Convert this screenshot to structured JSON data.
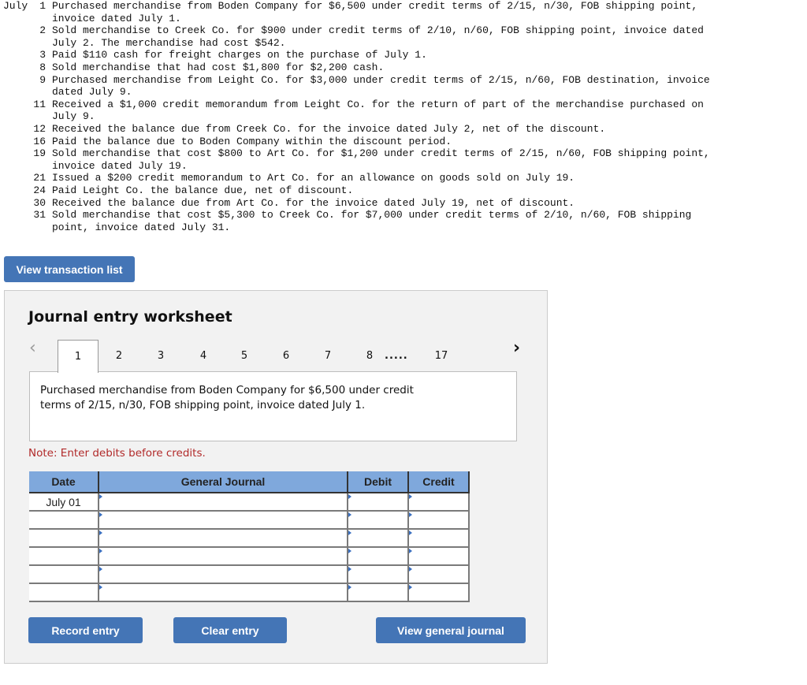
{
  "transactions": {
    "month": "July",
    "items": [
      {
        "day": "1",
        "text": "Purchased merchandise from Boden Company for $6,500 under credit terms of 2/15, n/30, FOB shipping point,\ninvoice dated July 1."
      },
      {
        "day": "2",
        "text": "Sold merchandise to Creek Co. for $900 under credit terms of 2/10, n/60, FOB shipping point, invoice dated\nJuly 2. The merchandise had cost $542."
      },
      {
        "day": "3",
        "text": "Paid $110 cash for freight charges on the purchase of July 1."
      },
      {
        "day": "8",
        "text": "Sold merchandise that had cost $1,800 for $2,200 cash."
      },
      {
        "day": "9",
        "text": "Purchased merchandise from Leight Co. for $3,000 under credit terms of 2/15, n/60, FOB destination, invoice\ndated July 9."
      },
      {
        "day": "11",
        "text": "Received a $1,000 credit memorandum from Leight Co. for the return of part of the merchandise purchased on\nJuly 9."
      },
      {
        "day": "12",
        "text": "Received the balance due from Creek Co. for the invoice dated July 2, net of the discount."
      },
      {
        "day": "16",
        "text": "Paid the balance due to Boden Company within the discount period."
      },
      {
        "day": "19",
        "text": "Sold merchandise that cost $800 to Art Co. for $1,200 under credit terms of 2/15, n/60, FOB shipping point,\ninvoice dated July 19."
      },
      {
        "day": "21",
        "text": "Issued a $200 credit memorandum to Art Co. for an allowance on goods sold on July 19."
      },
      {
        "day": "24",
        "text": "Paid Leight Co. the balance due, net of discount."
      },
      {
        "day": "30",
        "text": "Received the balance due from Art Co. for the invoice dated July 19, net of discount."
      },
      {
        "day": "31",
        "text": "Sold merchandise that cost $5,300 to Creek Co. for $7,000 under credit terms of 2/10, n/60, FOB shipping\npoint, invoice dated July 31."
      }
    ]
  },
  "buttons": {
    "view_transaction_list": "View transaction list",
    "record_entry": "Record entry",
    "clear_entry": "Clear entry",
    "view_general_journal": "View general journal"
  },
  "worksheet": {
    "title": "Journal entry worksheet",
    "nav_prev_icon": "chevron-left-icon",
    "nav_next_icon": "chevron-right-icon",
    "tabs": [
      "1",
      "2",
      "3",
      "4",
      "5",
      "6",
      "7",
      "8"
    ],
    "ellipsis": ".....",
    "last_tab": "17",
    "active_tab": "1",
    "description": "Purchased merchandise from Boden Company for $6,500 under credit terms of 2/15, n/30, FOB shipping point, invoice dated July 1.",
    "note": "Note: Enter debits before credits."
  },
  "journal_table": {
    "headers": {
      "date": "Date",
      "journal": "General Journal",
      "debit": "Debit",
      "credit": "Credit"
    },
    "rows": [
      {
        "date": "July 01",
        "account": "",
        "debit": "",
        "credit": ""
      },
      {
        "date": "",
        "account": "",
        "debit": "",
        "credit": ""
      },
      {
        "date": "",
        "account": "",
        "debit": "",
        "credit": ""
      },
      {
        "date": "",
        "account": "",
        "debit": "",
        "credit": ""
      },
      {
        "date": "",
        "account": "",
        "debit": "",
        "credit": ""
      },
      {
        "date": "",
        "account": "",
        "debit": "",
        "credit": ""
      }
    ]
  },
  "colors": {
    "button_bg": "#4475b6",
    "table_header_bg": "#7fa8dc",
    "note_text": "#b12a2a",
    "worksheet_bg": "#f2f2f2"
  }
}
